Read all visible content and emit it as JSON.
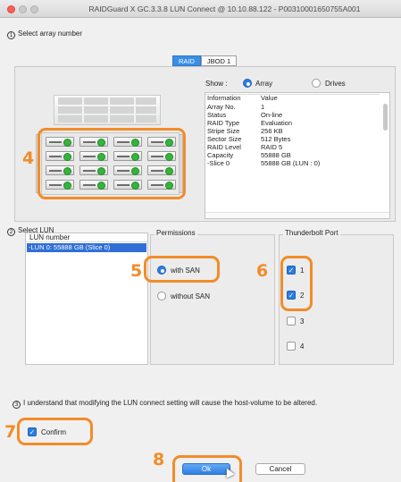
{
  "window": {
    "title": "RAIDGuard X GC.3.3.8 LUN Connect @ 10.10.88.122 - P00310001650755A001"
  },
  "step1": {
    "num": "1",
    "label": "Select array number"
  },
  "tabs": [
    {
      "label": "RAID",
      "active": true
    },
    {
      "label": "JBOD 1",
      "active": false
    }
  ],
  "show": {
    "label": "Show :",
    "options": [
      {
        "label": "Array",
        "selected": true
      },
      {
        "label": "Drives",
        "selected": false
      }
    ]
  },
  "info": {
    "columns": [
      "Information",
      "Value"
    ],
    "rows": [
      [
        "Array No.",
        "1"
      ],
      [
        "Status",
        "On-line"
      ],
      [
        "RAID Type",
        "Evaluation"
      ],
      [
        "Stripe Size",
        "256 KB"
      ],
      [
        "Sector Size",
        "512 Bytes"
      ],
      [
        "RAID Level",
        "RAID 5"
      ],
      [
        "Capacity",
        "55888 GB"
      ],
      [
        "-Slice 0",
        "55888 GB (LUN : 0)"
      ]
    ]
  },
  "step2": {
    "num": "2",
    "label": "Select LUN"
  },
  "lun": {
    "header": "LUN number",
    "items": [
      "-LUN 0: 55888 GB (Slice 0)"
    ]
  },
  "permissions": {
    "title": "Permissions",
    "options": [
      {
        "label": "with SAN",
        "selected": true
      },
      {
        "label": "without SAN",
        "selected": false
      }
    ]
  },
  "thunderbolt": {
    "title": "Thunderbolt Port",
    "ports": [
      {
        "label": "1",
        "checked": true
      },
      {
        "label": "2",
        "checked": true
      },
      {
        "label": "3",
        "checked": false
      },
      {
        "label": "4",
        "checked": false
      }
    ]
  },
  "step3": {
    "num": "3",
    "label": "I understand that modifying the LUN connect setting will cause the host-volume to be altered."
  },
  "confirm": {
    "label": "Confirm",
    "checked": true
  },
  "buttons": {
    "ok": "Ok",
    "cancel": "Cancel"
  },
  "callouts": [
    "4",
    "5",
    "6",
    "7",
    "8"
  ],
  "colors": {
    "accent": "#2a7de1",
    "highlight": "#f28c28",
    "drive_led": "#33b53a"
  }
}
